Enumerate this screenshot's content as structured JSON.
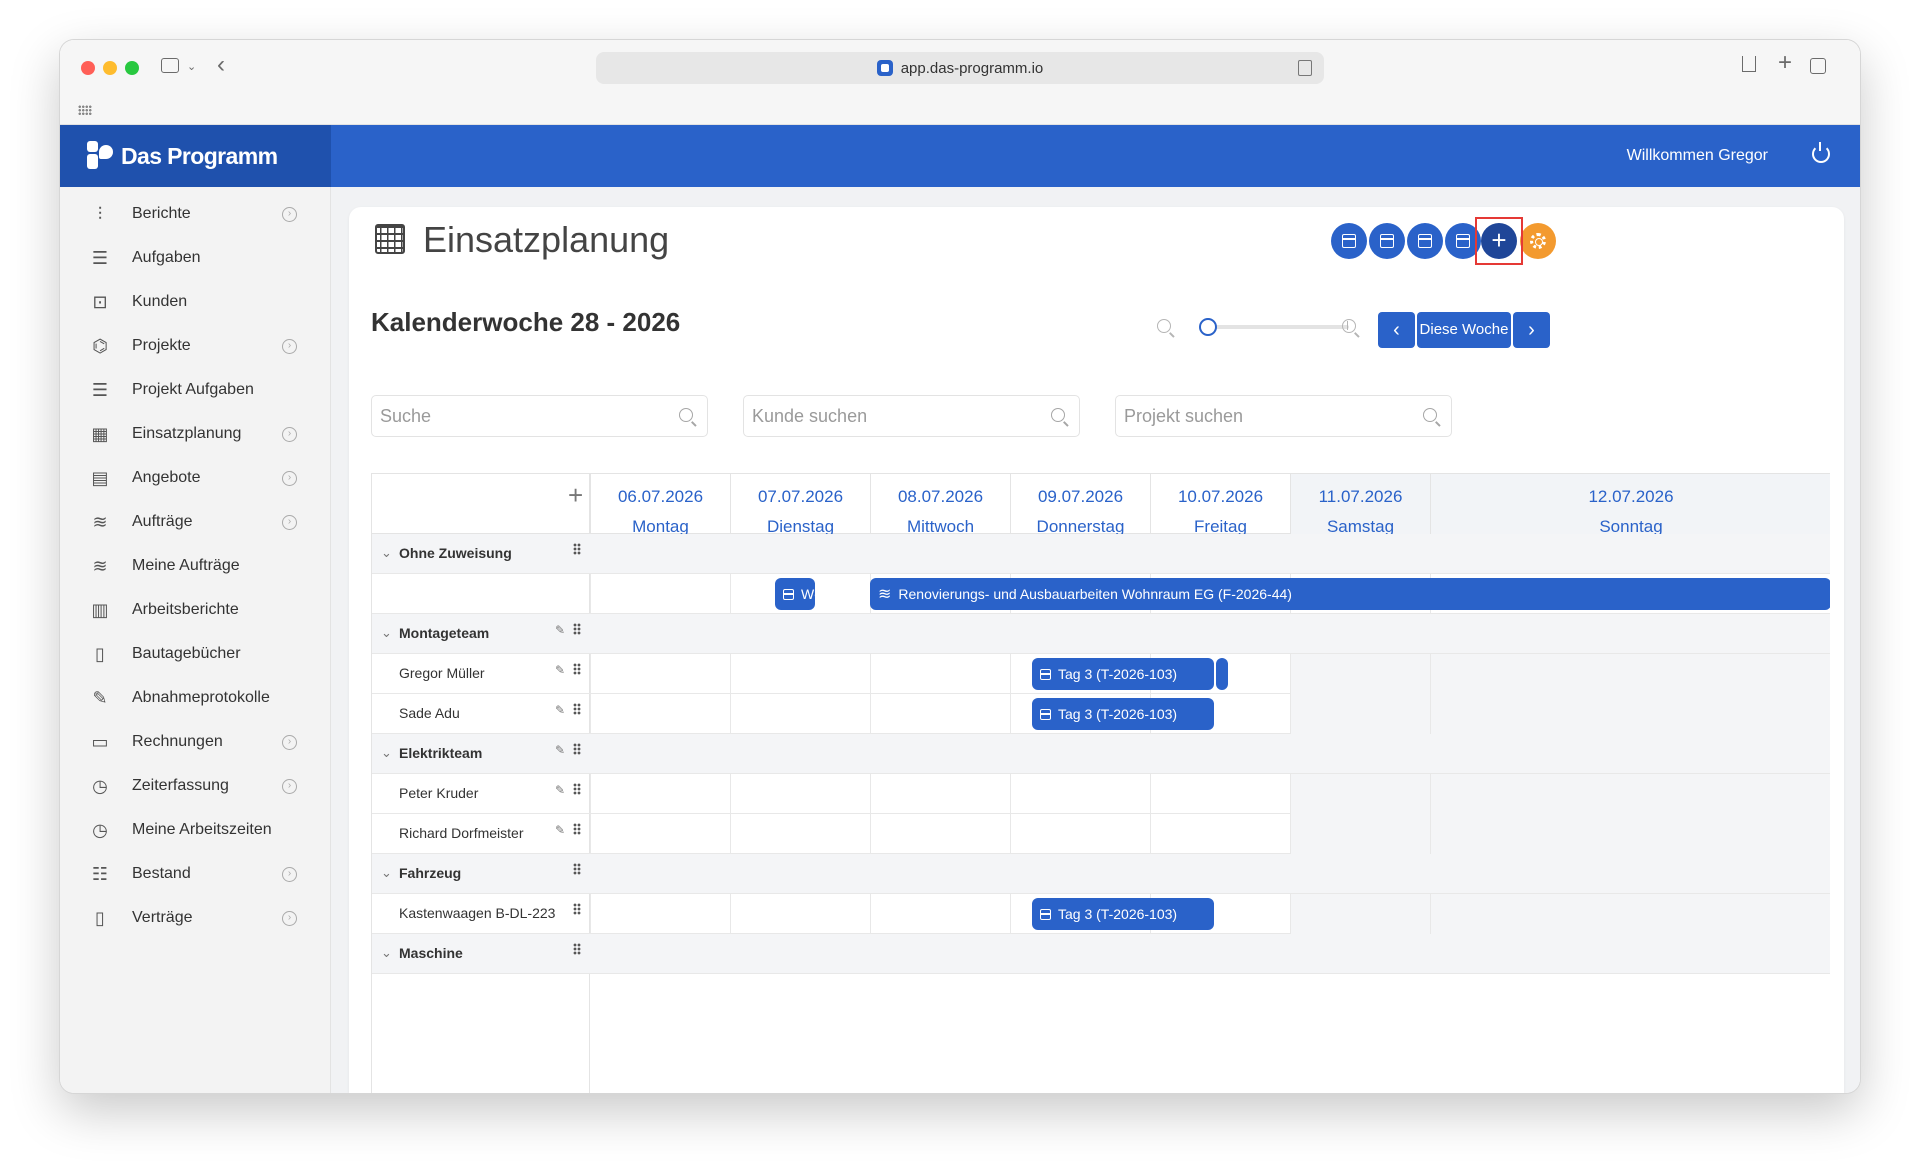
{
  "browser": {
    "url": "app.das-programm.io"
  },
  "app": {
    "brand": "Das Programm",
    "welcome": "Willkommen Gregor"
  },
  "sidebar": {
    "items": [
      {
        "label": "Berichte",
        "icon": "chart-icon",
        "expandable": true
      },
      {
        "label": "Aufgaben",
        "icon": "list-icon",
        "expandable": false
      },
      {
        "label": "Kunden",
        "icon": "contact-icon",
        "expandable": false
      },
      {
        "label": "Projekte",
        "icon": "project-icon",
        "expandable": true
      },
      {
        "label": "Projekt Aufgaben",
        "icon": "list-icon",
        "expandable": false
      },
      {
        "label": "Einsatzplanung",
        "icon": "calendar-icon",
        "expandable": true
      },
      {
        "label": "Angebote",
        "icon": "calculator-icon",
        "expandable": true
      },
      {
        "label": "Aufträge",
        "icon": "handshake-icon",
        "expandable": true
      },
      {
        "label": "Meine Aufträge",
        "icon": "handshake-icon",
        "expandable": false
      },
      {
        "label": "Arbeitsberichte",
        "icon": "report-icon",
        "expandable": false
      },
      {
        "label": "Bautagebücher",
        "icon": "book-icon",
        "expandable": false
      },
      {
        "label": "Abnahmeprotokolle",
        "icon": "signature-icon",
        "expandable": false
      },
      {
        "label": "Rechnungen",
        "icon": "invoice-icon",
        "expandable": true
      },
      {
        "label": "Zeiterfassung",
        "icon": "clock-icon",
        "expandable": true
      },
      {
        "label": "Meine Arbeitszeiten",
        "icon": "clock-icon",
        "expandable": false
      },
      {
        "label": "Bestand",
        "icon": "stock-icon",
        "expandable": true
      },
      {
        "label": "Verträge",
        "icon": "contract-icon",
        "expandable": true
      }
    ]
  },
  "main": {
    "title": "Einsatzplanung",
    "week_title": "Kalenderwoche 28 - 2026",
    "this_week_label": "Diese Woche",
    "zoom_level": 0,
    "search": {
      "general_placeholder": "Suche",
      "customer_placeholder": "Kunde suchen",
      "project_placeholder": "Projekt suchen"
    },
    "days": [
      {
        "date": "06.07.2026",
        "weekday": "Montag"
      },
      {
        "date": "07.07.2026",
        "weekday": "Dienstag"
      },
      {
        "date": "08.07.2026",
        "weekday": "Mittwoch"
      },
      {
        "date": "09.07.2026",
        "weekday": "Donnerstag"
      },
      {
        "date": "10.07.2026",
        "weekday": "Freitag"
      },
      {
        "date": "11.07.2026",
        "weekday": "Samstag"
      },
      {
        "date": "12.07.2026",
        "weekday": "Sonntag"
      }
    ],
    "rows": [
      {
        "group": "Ohne Zuweisung"
      },
      {
        "group": "Montageteam"
      },
      {
        "resource": "Gregor Müller"
      },
      {
        "resource": "Sade Adu"
      },
      {
        "group": "Elektrikteam"
      },
      {
        "resource": "Peter Kruder"
      },
      {
        "resource": "Richard Dorfmeister"
      },
      {
        "group": "Fahrzeug"
      },
      {
        "resource": "Kastenwaagen B-DL-223"
      },
      {
        "group": "Maschine"
      }
    ],
    "events": {
      "short_unassigned": "Wö",
      "order_unassigned": "Renovierungs- und Ausbauarbeiten Wohnraum EG (F-2026-44)",
      "task_gregor": "Tag 3 (T-2026-103)",
      "task_sade": "Tag 3 (T-2026-103)",
      "task_vehicle": "Tag 3 (T-2026-103)"
    }
  },
  "colors": {
    "primary": "#2a62c9",
    "brand_dark": "#1f51ad",
    "settings": "#f39a2f"
  }
}
